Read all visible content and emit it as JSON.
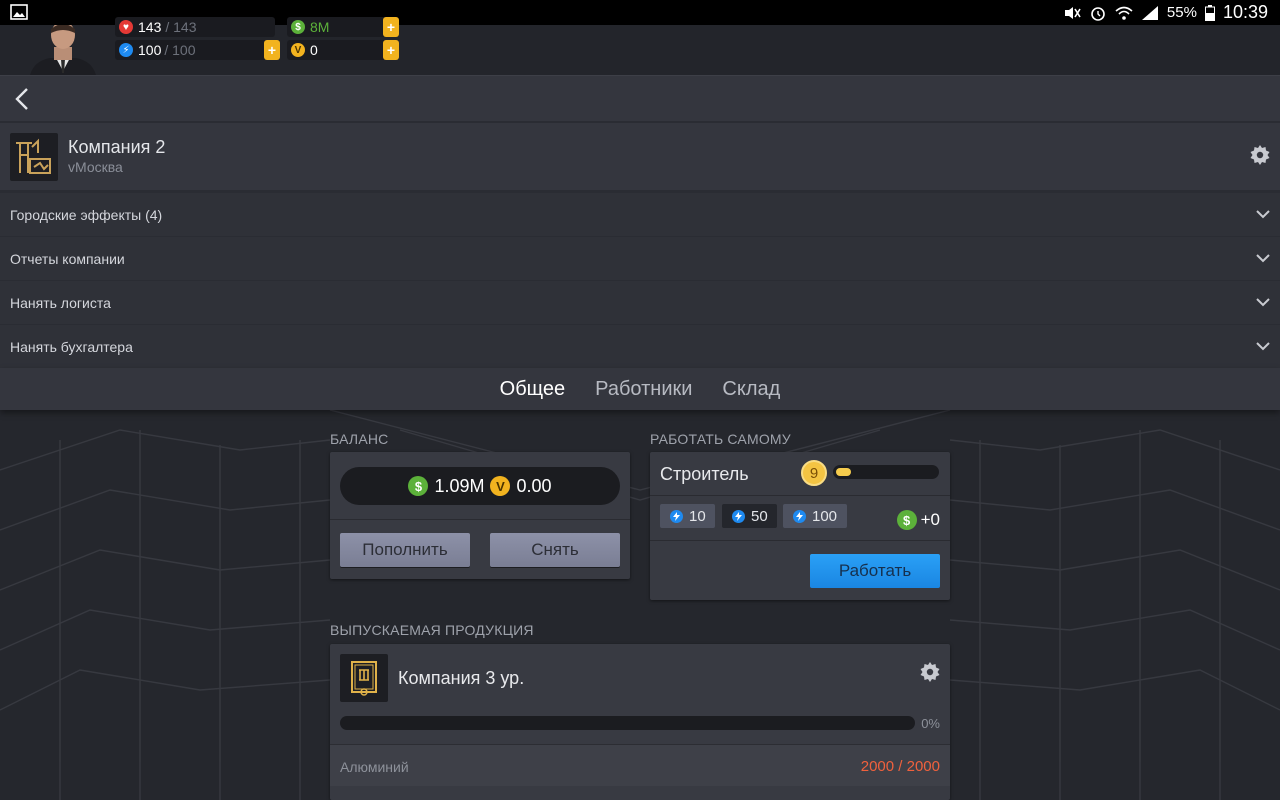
{
  "status_bar": {
    "battery": "55%",
    "time": "10:39"
  },
  "player": {
    "health_value": "143",
    "health_max": "/ 143",
    "energy_value": "100",
    "energy_max": "/ 100",
    "money_value": "8M",
    "vcoins_value": "0",
    "plus_label": "+"
  },
  "header": {
    "back_icon": "chevron-left-icon"
  },
  "company": {
    "name": "Компания 2",
    "city": "vМосква"
  },
  "accordion": [
    {
      "label": "Городские эффекты (4)"
    },
    {
      "label": "Отчеты компании"
    },
    {
      "label": "Нанять логиста"
    },
    {
      "label": "Нанять бухгалтера"
    }
  ],
  "tabs": [
    {
      "label": "Общее",
      "active": true
    },
    {
      "label": "Работники",
      "active": false
    },
    {
      "label": "Склад",
      "active": false
    }
  ],
  "balance": {
    "title": "БАЛАНС",
    "money": "1.09M",
    "vcoins": "0.00",
    "money_icon": "$",
    "vcoin_icon": "V",
    "deposit_label": "Пополнить",
    "withdraw_label": "Снять"
  },
  "work": {
    "title": "РАБОТАТЬ САМОМУ",
    "job": "Строитель",
    "level": "9",
    "level_progress": 0.15,
    "energy_options": [
      "10",
      "50",
      "100"
    ],
    "selected_option": "50",
    "earn": "+0",
    "work_label": "Работать"
  },
  "production": {
    "title": "ВЫПУСКАЕМАЯ ПРОДУКЦИЯ",
    "name": "Компания 3 ур.",
    "progress": 0,
    "progress_label": "0%",
    "resource_name": "Алюминий",
    "resource_value": "2000 / 2000"
  },
  "colors": {
    "accent_blue": "#1e8af0",
    "gold": "#f2b31f",
    "money_green": "#5cb13a",
    "warning_red": "#f0613d"
  }
}
